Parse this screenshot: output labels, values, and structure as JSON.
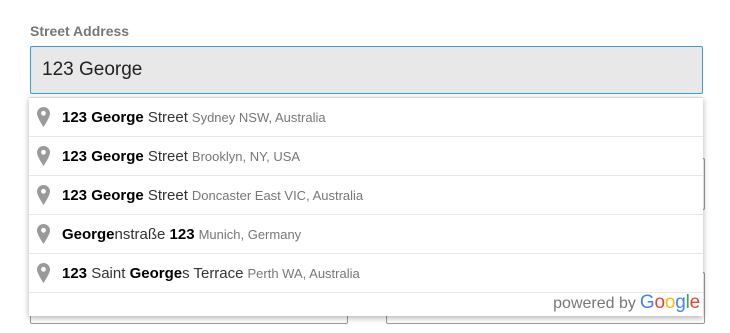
{
  "form": {
    "street_label": "Street Address",
    "street_value": "123 George"
  },
  "autocomplete": {
    "icon": "map-pin-icon",
    "suggestions": [
      {
        "parts": [
          {
            "text": "123",
            "match": true
          },
          {
            "text": " ",
            "match": false
          },
          {
            "text": "George",
            "match": true
          },
          {
            "text": " Street",
            "match": false
          }
        ],
        "secondary": "Sydney NSW, Australia"
      },
      {
        "parts": [
          {
            "text": "123",
            "match": true
          },
          {
            "text": " ",
            "match": false
          },
          {
            "text": "George",
            "match": true
          },
          {
            "text": " Street",
            "match": false
          }
        ],
        "secondary": "Brooklyn, NY, USA"
      },
      {
        "parts": [
          {
            "text": "123",
            "match": true
          },
          {
            "text": " ",
            "match": false
          },
          {
            "text": "George",
            "match": true
          },
          {
            "text": " Street",
            "match": false
          }
        ],
        "secondary": "Doncaster East VIC, Australia"
      },
      {
        "parts": [
          {
            "text": "George",
            "match": true
          },
          {
            "text": "nstraße ",
            "match": false
          },
          {
            "text": "123",
            "match": true
          }
        ],
        "secondary": "Munich, Germany"
      },
      {
        "parts": [
          {
            "text": "123",
            "match": true
          },
          {
            "text": " Saint ",
            "match": false
          },
          {
            "text": "George",
            "match": true
          },
          {
            "text": "s Terrace",
            "match": false
          }
        ],
        "secondary": "Perth WA, Australia"
      }
    ],
    "attribution": {
      "prefix": "powered by",
      "brand": "Google",
      "brand_colors": [
        "#4285F4",
        "#EA4335",
        "#FBBC05",
        "#4285F4",
        "#34A853",
        "#EA4335"
      ]
    }
  }
}
